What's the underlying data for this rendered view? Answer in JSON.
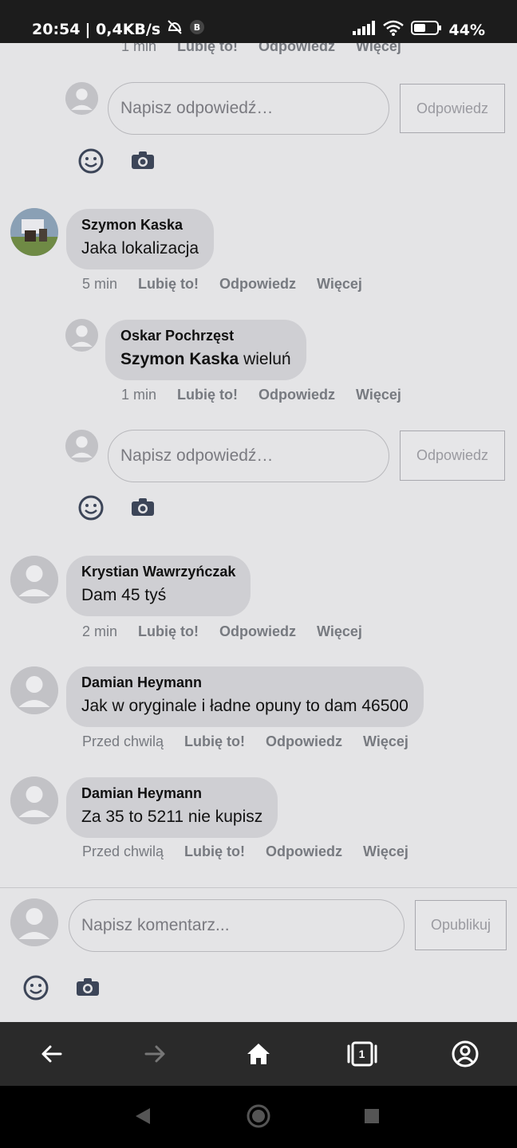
{
  "status_bar": {
    "time": "20:54",
    "speed": "| 0,4KB/s",
    "battery": "44%"
  },
  "colors": {
    "page_bg": "#e4e4e6",
    "bubble_bg": "#cfcfd3",
    "meta_text": "#777a80",
    "nav_bg": "#2a2a2a"
  },
  "top_partial_meta": {
    "time": "1 min",
    "like": "Lubię to!",
    "reply": "Odpowiedz",
    "more": "Więcej"
  },
  "reply_box_1": {
    "placeholder": "Napisz odpowiedź…",
    "button": "Odpowiedz"
  },
  "comments": [
    {
      "author": "Szymon Kaska",
      "text": "Jaka lokalizacja",
      "time": "5 min",
      "like": "Lubię to!",
      "reply": "Odpowiedz",
      "more": "Więcej"
    },
    {
      "author": "Krystian Wawrzyńczak",
      "text": "Dam 45 tyś",
      "time": "2 min",
      "like": "Lubię to!",
      "reply": "Odpowiedz",
      "more": "Więcej"
    },
    {
      "author": "Damian Heymann",
      "text": "Jak w oryginale i ładne opuny to dam 46500",
      "time": "Przed chwilą",
      "like": "Lubię to!",
      "reply": "Odpowiedz",
      "more": "Więcej"
    },
    {
      "author": "Damian Heymann",
      "text": "Za 35 to 5211 nie kupisz",
      "time": "Przed chwilą",
      "like": "Lubię to!",
      "reply": "Odpowiedz",
      "more": "Więcej"
    }
  ],
  "nested_reply": {
    "author": "Oskar Pochrzęst",
    "mention": "Szymon Kaska",
    "text": " wieluń",
    "time": "1 min",
    "like": "Lubię to!",
    "reply": "Odpowiedz",
    "more": "Więcej"
  },
  "reply_box_2": {
    "placeholder": "Napisz odpowiedź…",
    "button": "Odpowiedz"
  },
  "comment_box": {
    "placeholder": "Napisz komentarz...",
    "button": "Opublikuj"
  },
  "browser_nav": {
    "tab_count": "1",
    "icons": [
      "back-arrow-icon",
      "forward-arrow-icon",
      "home-icon",
      "tabs-icon",
      "account-icon"
    ]
  }
}
